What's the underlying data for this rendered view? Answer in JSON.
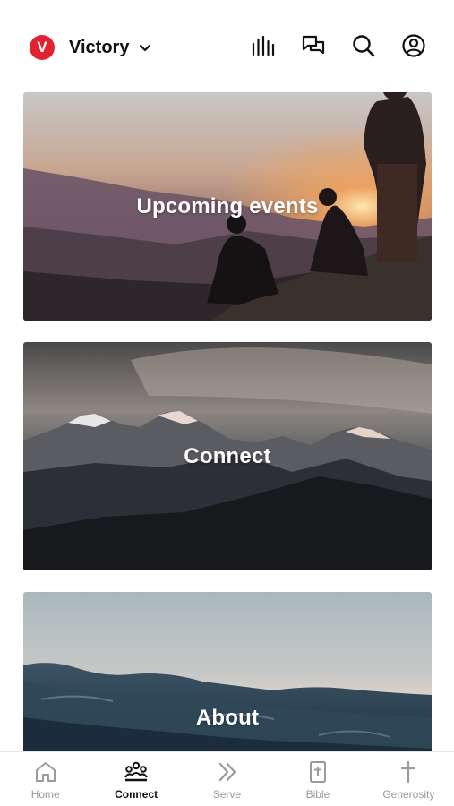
{
  "header": {
    "logo_letter": "V",
    "brand": "Victory"
  },
  "cards": [
    {
      "title": "Upcoming events"
    },
    {
      "title": "Connect"
    },
    {
      "title": "About"
    }
  ],
  "nav": {
    "items": [
      {
        "label": "Home",
        "active": false
      },
      {
        "label": "Connect",
        "active": true
      },
      {
        "label": "Serve",
        "active": false
      },
      {
        "label": "Bible",
        "active": false
      },
      {
        "label": "Generosity",
        "active": false
      }
    ]
  },
  "colors": {
    "brand_red": "#e0232e",
    "active_text": "#111111",
    "inactive_text": "#9a9a9a"
  },
  "icons": [
    "chevron-down-icon",
    "audio-bars-icon",
    "chat-icon",
    "search-icon",
    "profile-icon",
    "home-icon",
    "group-icon",
    "chevrons-right-icon",
    "bible-icon",
    "cross-icon"
  ]
}
